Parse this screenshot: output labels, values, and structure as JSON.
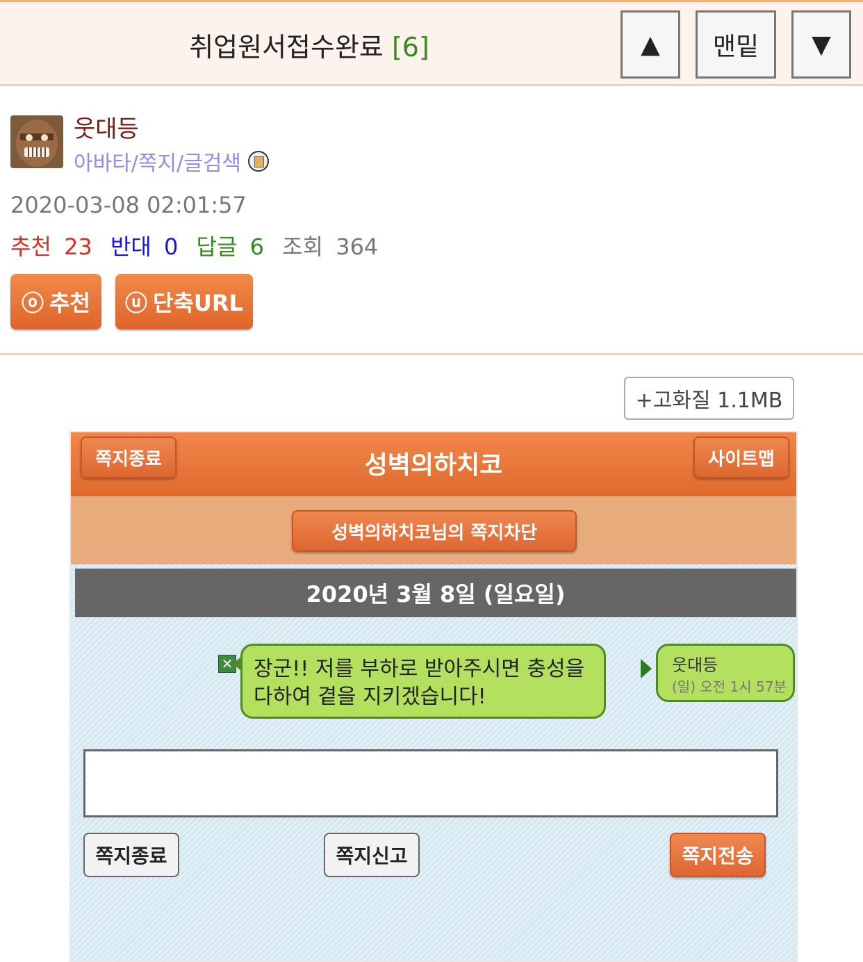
{
  "header": {
    "title": "취업원서접수완료",
    "comment_count": "[6]",
    "up_label": "▲",
    "bottom_label": "맨밑",
    "down_label": "▼"
  },
  "author": {
    "name": "웃대등",
    "links": "아바타/쪽지/글검색"
  },
  "post": {
    "datetime": "2020-03-08 02:01:57",
    "stats": {
      "recommend_label": "추천",
      "recommend_value": "23",
      "oppose_label": "반대",
      "oppose_value": "0",
      "reply_label": "답글",
      "reply_value": "6",
      "view_label": "조회",
      "view_value": "364"
    }
  },
  "actions": {
    "recommend_icon": "ⓞ",
    "recommend_label": "추천",
    "short_url_icon": "ⓤ",
    "short_url_label": "단축URL"
  },
  "image": {
    "hq_label": "+고화질 1.1MB"
  },
  "screenshot": {
    "header_title": "성벽의하치코",
    "exit_label": "쪽지종료",
    "sitemap_label": "사이트맵",
    "block_label": "성벽의하치코님의 쪽지차단",
    "date": "2020년 3월 8일 (일요일)",
    "message_line1": "장군!! 저를 부하로 받아주시면 충성을",
    "message_line2": "다하여 곁을 지키겠습니다!",
    "sender_name": "웃대등",
    "sender_time": "(일) 오전 1시 57분",
    "delete_mark": "✕",
    "bottom_exit_label": "쪽지종료",
    "report_label": "쪽지신고",
    "send_label": "쪽지전송"
  },
  "colors": {
    "accent": "#e0642a",
    "recommend": "#e02b20",
    "oppose": "#1414e6",
    "reply": "#2f8a1f",
    "author": "#7a1a14",
    "links": "#8d8ee6"
  }
}
